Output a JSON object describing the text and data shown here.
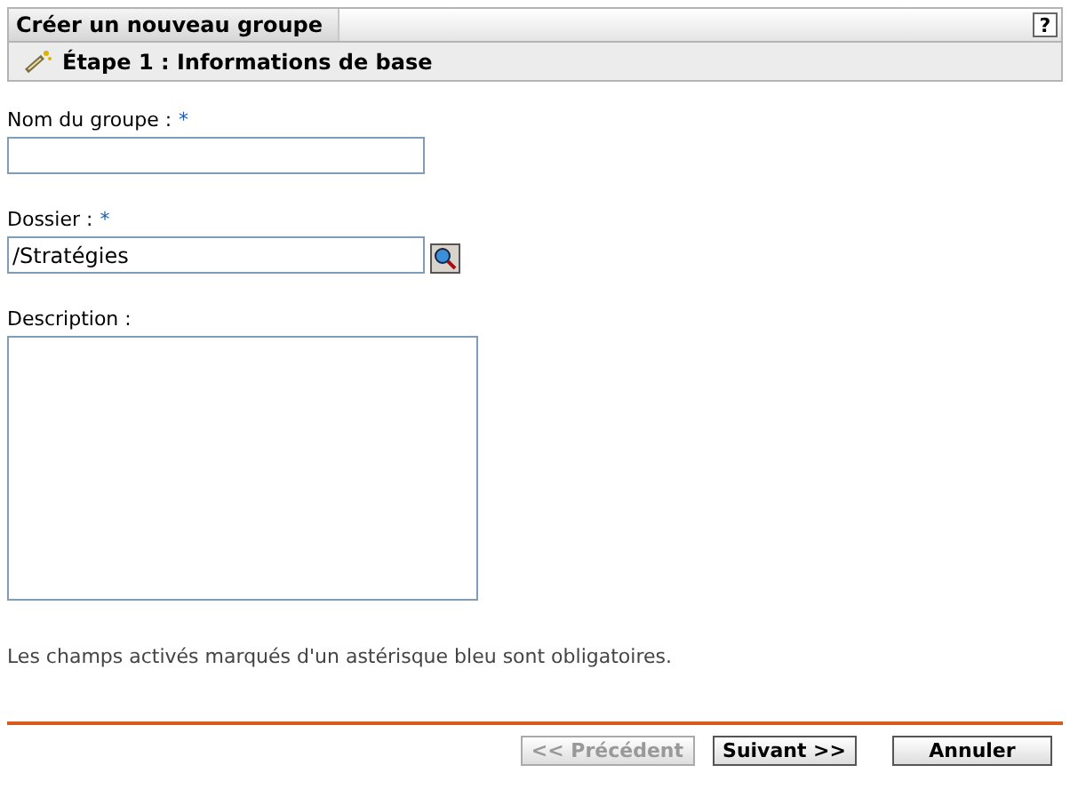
{
  "header": {
    "title": "Créer un nouveau groupe",
    "help": "?"
  },
  "step": {
    "title": "Étape 1 : Informations de base"
  },
  "fields": [
    {
      "kind": "text",
      "label": "Nom du groupe :",
      "required_mark": "*"
    },
    {
      "kind": "browse",
      "label": "Dossier :",
      "required_mark": "*",
      "value": "/Stratégies"
    },
    {
      "kind": "area",
      "label": "Description :"
    }
  ],
  "note": "Les champs activés marqués d'un astérisque bleu sont obligatoires.",
  "buttons": [
    {
      "label": "<< Précédent",
      "disabled": true
    },
    {
      "label": "Suivant >>",
      "disabled": false
    },
    {
      "label": "Annuler",
      "disabled": false
    }
  ]
}
